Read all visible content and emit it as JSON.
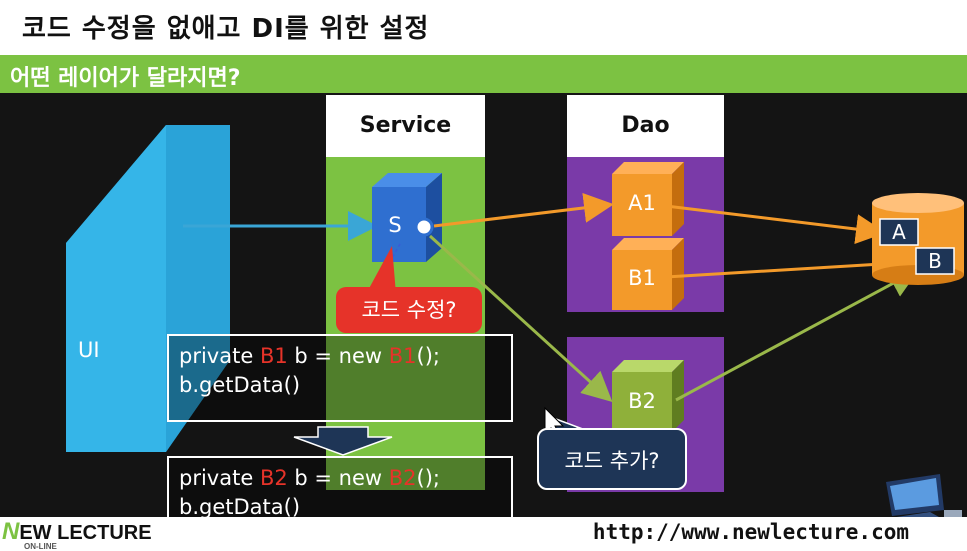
{
  "slide": {
    "title": "코드 수정을 없애고 DI를 위한 설정",
    "subtitle": "어떤 레이어가 달라지면?"
  },
  "layers": {
    "ui_label": "UI",
    "service_header": "Service",
    "dao_header": "Dao",
    "service_node": "S",
    "dao_nodes": [
      "A1",
      "B1",
      "B2"
    ],
    "db_items": [
      "A",
      "B"
    ]
  },
  "code_before": {
    "line1_prefix": "private ",
    "line1_type": "B1",
    "line1_mid": " b = new ",
    "line1_ctor": "B1",
    "line1_suffix": "();",
    "line2": "b.getData()"
  },
  "code_after": {
    "line1_prefix": "private ",
    "line1_type": "B2",
    "line1_mid": " b = new ",
    "line1_ctor": "B2",
    "line1_suffix": "();",
    "line2": "b.getData()"
  },
  "callouts": {
    "modify": "코드 수정?",
    "add": "코드 추가?"
  },
  "footer": {
    "logo_n": "N",
    "logo_rest": "EW LECTURE",
    "logo_sub": "ON-LINE",
    "url": "http://www.newlecture.com"
  },
  "colors": {
    "green": "#7cc242",
    "purple": "#7a3aa8",
    "orange": "#f39a2a",
    "blue": "#2f6fd0",
    "ui_blue": "#2aa3d8",
    "red": "#e63329",
    "navy": "#1e3556"
  }
}
